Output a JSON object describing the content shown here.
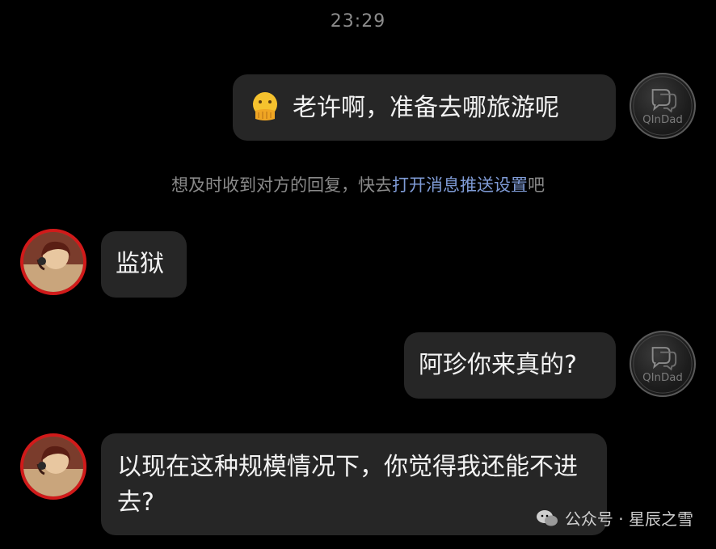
{
  "timestamp": "23:29",
  "messages": [
    {
      "sender": "self",
      "emoji": "face-with-hand-over-mouth",
      "text": "老许啊，准备去哪旅游呢"
    },
    {
      "sender": "other",
      "text": "监狱"
    },
    {
      "sender": "self",
      "text": "阿珍你来真的?"
    },
    {
      "sender": "other",
      "text": "以现在这种规模情况下，你觉得我还能不进去?"
    }
  ],
  "system_note": {
    "prefix": "想及时收到对方的回复，快去",
    "link": "打开消息推送设置",
    "suffix": "吧"
  },
  "watermark": {
    "text": "公众号 · 星辰之雪",
    "icon": "wechat-icon"
  },
  "colors": {
    "background": "#000000",
    "bubble": "#262626",
    "link": "#7f9bd6",
    "avatar_ring": "#d11a1a"
  }
}
